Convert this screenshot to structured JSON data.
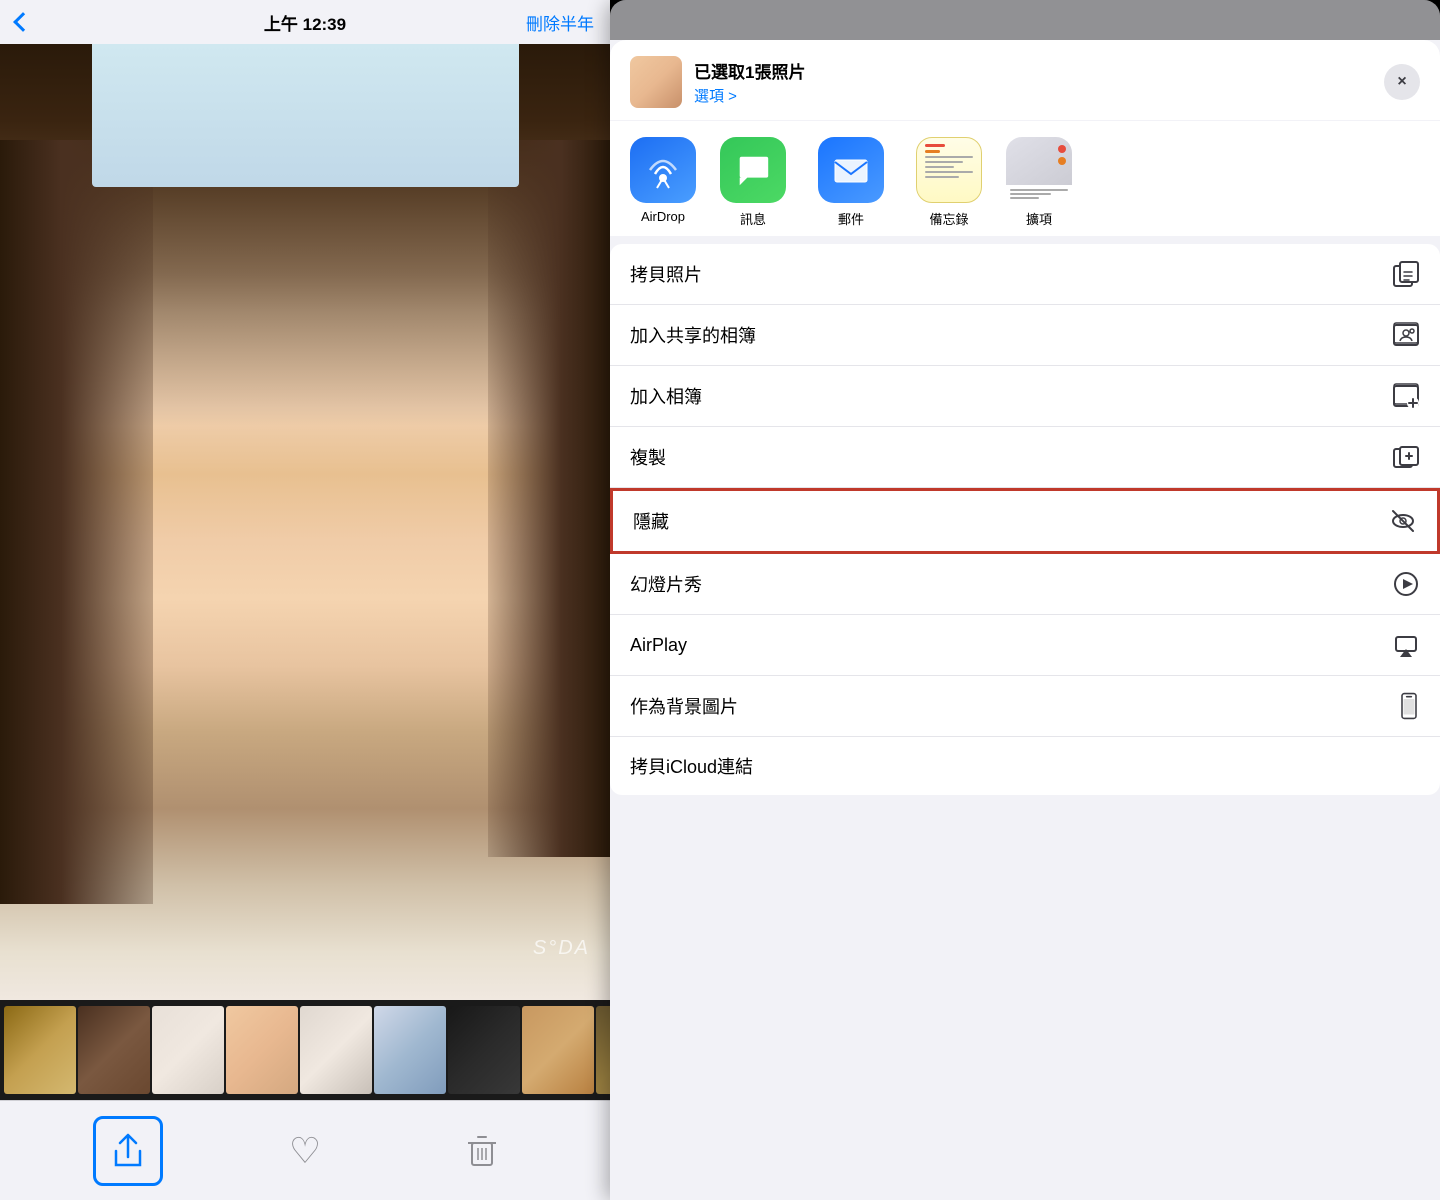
{
  "statusBar": {
    "time": "上午 12:39",
    "rightAction": "刪除半年"
  },
  "shareSheet": {
    "title": "已選取1張照片",
    "subtitle": "選項 >",
    "closeLabel": "×",
    "apps": [
      {
        "id": "airdrop",
        "label": "AirDrop"
      },
      {
        "id": "messages",
        "label": "訊息"
      },
      {
        "id": "mail",
        "label": "郵件"
      },
      {
        "id": "notes",
        "label": "備忘錄"
      },
      {
        "id": "more",
        "label": "擴項"
      }
    ],
    "actions": [
      {
        "id": "copy-photo",
        "label": "拷貝照片",
        "icon": "copy"
      },
      {
        "id": "add-shared-album",
        "label": "加入共享的相簿",
        "icon": "shared-album"
      },
      {
        "id": "add-album",
        "label": "加入相簿",
        "icon": "add-album"
      },
      {
        "id": "duplicate",
        "label": "複製",
        "icon": "duplicate"
      },
      {
        "id": "hide",
        "label": "隱藏",
        "icon": "hide",
        "highlighted": true
      },
      {
        "id": "slideshow",
        "label": "幻燈片秀",
        "icon": "play"
      },
      {
        "id": "airplay",
        "label": "AirPlay",
        "icon": "airplay"
      },
      {
        "id": "wallpaper",
        "label": "作為背景圖片",
        "icon": "phone"
      },
      {
        "id": "assign",
        "label": "拷貝iCloud連結",
        "icon": "link"
      }
    ]
  },
  "watermark": "S°DA"
}
